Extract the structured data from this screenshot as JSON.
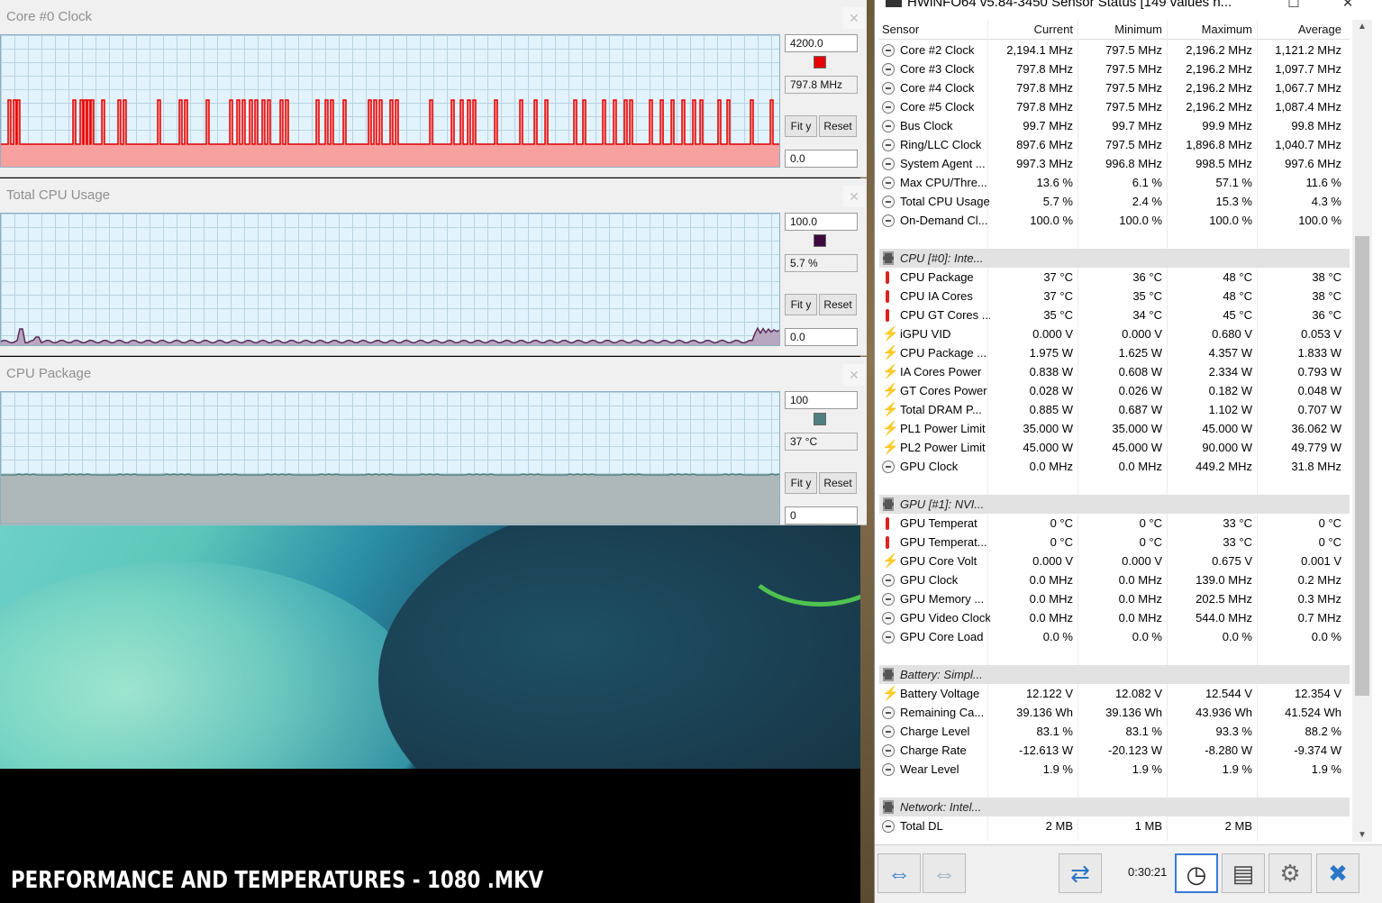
{
  "graphs": [
    {
      "title": "Core #0 Clock",
      "max": "4200.0",
      "current": "797.8 MHz",
      "min": "0.0",
      "color": "#e60000",
      "fit_label": "Fit y",
      "reset_label": "Reset"
    },
    {
      "title": "Total CPU Usage",
      "max": "100.0",
      "current": "5.7 %",
      "min": "0.0",
      "color": "#3c0a3c",
      "fit_label": "Fit y",
      "reset_label": "Reset"
    },
    {
      "title": "CPU Package",
      "max": "100",
      "current": "37 °C",
      "min": "0",
      "color": "#4f7f7f",
      "fit_label": "Fit y",
      "reset_label": "Reset"
    }
  ],
  "video_caption": "PERFORMANCE AND TEMPERATURES - 1080 .MKV",
  "hwinfo": {
    "title": "HWiNFO64 v5.84-3450 Sensor Status [149 values h...",
    "columns": {
      "sensor": "Sensor",
      "current": "Current",
      "minimum": "Minimum",
      "maximum": "Maximum",
      "average": "Average"
    },
    "timer": "0:30:21",
    "rows": [
      {
        "type": "clock",
        "name": "Core #2 Clock",
        "cur": "2,194.1 MHz",
        "min": "797.5 MHz",
        "max": "2,196.2 MHz",
        "avg": "1,121.2 MHz"
      },
      {
        "type": "clock",
        "name": "Core #3 Clock",
        "cur": "797.8 MHz",
        "min": "797.5 MHz",
        "max": "2,196.2 MHz",
        "avg": "1,097.7 MHz"
      },
      {
        "type": "clock",
        "name": "Core #4 Clock",
        "cur": "797.8 MHz",
        "min": "797.5 MHz",
        "max": "2,196.2 MHz",
        "avg": "1,067.7 MHz"
      },
      {
        "type": "clock",
        "name": "Core #5 Clock",
        "cur": "797.8 MHz",
        "min": "797.5 MHz",
        "max": "2,196.2 MHz",
        "avg": "1,087.4 MHz"
      },
      {
        "type": "clock",
        "name": "Bus Clock",
        "cur": "99.7 MHz",
        "min": "99.7 MHz",
        "max": "99.9 MHz",
        "avg": "99.8 MHz"
      },
      {
        "type": "clock",
        "name": "Ring/LLC Clock",
        "cur": "897.6 MHz",
        "min": "797.5 MHz",
        "max": "1,896.8 MHz",
        "avg": "1,040.7 MHz"
      },
      {
        "type": "clock",
        "name": "System Agent ...",
        "cur": "997.3 MHz",
        "min": "996.8 MHz",
        "max": "998.5 MHz",
        "avg": "997.6 MHz"
      },
      {
        "type": "clock",
        "name": "Max CPU/Thre...",
        "cur": "13.6 %",
        "min": "6.1 %",
        "max": "57.1 %",
        "avg": "11.6 %"
      },
      {
        "type": "clock",
        "name": "Total CPU Usage",
        "cur": "5.7 %",
        "min": "2.4 %",
        "max": "15.3 %",
        "avg": "4.3 %"
      },
      {
        "type": "clock",
        "name": "On-Demand Cl...",
        "cur": "100.0 %",
        "min": "100.0 %",
        "max": "100.0 %",
        "avg": "100.0 %"
      },
      {
        "type": "blank",
        "name": "",
        "cur": "",
        "min": "",
        "max": "",
        "avg": ""
      },
      {
        "type": "group",
        "name": "CPU [#0]: Inte...",
        "cur": "",
        "min": "",
        "max": "",
        "avg": ""
      },
      {
        "type": "temp",
        "name": "CPU Package",
        "cur": "37 °C",
        "min": "36 °C",
        "max": "48 °C",
        "avg": "38 °C"
      },
      {
        "type": "temp",
        "name": "CPU IA Cores",
        "cur": "37 °C",
        "min": "35 °C",
        "max": "48 °C",
        "avg": "38 °C"
      },
      {
        "type": "temp",
        "name": "CPU GT Cores ...",
        "cur": "35 °C",
        "min": "34 °C",
        "max": "45 °C",
        "avg": "36 °C"
      },
      {
        "type": "volt",
        "name": "iGPU VID",
        "cur": "0.000 V",
        "min": "0.000 V",
        "max": "0.680 V",
        "avg": "0.053 V"
      },
      {
        "type": "volt",
        "name": "CPU Package ...",
        "cur": "1.975 W",
        "min": "1.625 W",
        "max": "4.357 W",
        "avg": "1.833 W"
      },
      {
        "type": "volt",
        "name": "IA Cores Power",
        "cur": "0.838 W",
        "min": "0.608 W",
        "max": "2.334 W",
        "avg": "0.793 W"
      },
      {
        "type": "volt",
        "name": "GT Cores Power",
        "cur": "0.028 W",
        "min": "0.026 W",
        "max": "0.182 W",
        "avg": "0.048 W"
      },
      {
        "type": "volt",
        "name": "Total DRAM P...",
        "cur": "0.885 W",
        "min": "0.687 W",
        "max": "1.102 W",
        "avg": "0.707 W"
      },
      {
        "type": "volt",
        "name": "PL1 Power Limit",
        "cur": "35.000 W",
        "min": "35.000 W",
        "max": "45.000 W",
        "avg": "36.062 W"
      },
      {
        "type": "volt",
        "name": "PL2 Power Limit",
        "cur": "45.000 W",
        "min": "45.000 W",
        "max": "90.000 W",
        "avg": "49.779 W"
      },
      {
        "type": "clock",
        "name": "GPU Clock",
        "cur": "0.0 MHz",
        "min": "0.0 MHz",
        "max": "449.2 MHz",
        "avg": "31.8 MHz"
      },
      {
        "type": "blank",
        "name": "",
        "cur": "",
        "min": "",
        "max": "",
        "avg": ""
      },
      {
        "type": "group",
        "name": "GPU [#1]: NVI...",
        "cur": "",
        "min": "",
        "max": "",
        "avg": ""
      },
      {
        "type": "temp",
        "name": "GPU Temperat",
        "cur": "0 °C",
        "min": "0 °C",
        "max": "33 °C",
        "avg": "0 °C"
      },
      {
        "type": "temp",
        "name": "GPU Temperat...",
        "cur": "0 °C",
        "min": "0 °C",
        "max": "33 °C",
        "avg": "0 °C"
      },
      {
        "type": "volt",
        "name": "GPU Core Volt",
        "cur": "0.000 V",
        "min": "0.000 V",
        "max": "0.675 V",
        "avg": "0.001 V"
      },
      {
        "type": "clock",
        "name": "GPU Clock",
        "cur": "0.0 MHz",
        "min": "0.0 MHz",
        "max": "139.0 MHz",
        "avg": "0.2 MHz"
      },
      {
        "type": "clock",
        "name": "GPU Memory ...",
        "cur": "0.0 MHz",
        "min": "0.0 MHz",
        "max": "202.5 MHz",
        "avg": "0.3 MHz"
      },
      {
        "type": "clock",
        "name": "GPU Video Clock",
        "cur": "0.0 MHz",
        "min": "0.0 MHz",
        "max": "544.0 MHz",
        "avg": "0.7 MHz"
      },
      {
        "type": "clock",
        "name": "GPU Core Load",
        "cur": "0.0 %",
        "min": "0.0 %",
        "max": "0.0 %",
        "avg": "0.0 %"
      },
      {
        "type": "blank",
        "name": "",
        "cur": "",
        "min": "",
        "max": "",
        "avg": ""
      },
      {
        "type": "group",
        "name": "Battery: Simpl...",
        "cur": "",
        "min": "",
        "max": "",
        "avg": ""
      },
      {
        "type": "volt",
        "name": "Battery Voltage",
        "cur": "12.122 V",
        "min": "12.082 V",
        "max": "12.544 V",
        "avg": "12.354 V"
      },
      {
        "type": "clock",
        "name": "Remaining Ca...",
        "cur": "39.136 Wh",
        "min": "39.136 Wh",
        "max": "43.936 Wh",
        "avg": "41.524 Wh"
      },
      {
        "type": "clock",
        "name": "Charge Level",
        "cur": "83.1 %",
        "min": "83.1 %",
        "max": "93.3 %",
        "avg": "88.2 %"
      },
      {
        "type": "clock",
        "name": "Charge Rate",
        "cur": "-12.613 W",
        "min": "-20.123 W",
        "max": "-8.280 W",
        "avg": "-9.374 W"
      },
      {
        "type": "clock",
        "name": "Wear Level",
        "cur": "1.9 %",
        "min": "1.9 %",
        "max": "1.9 %",
        "avg": "1.9 %"
      },
      {
        "type": "blank",
        "name": "",
        "cur": "",
        "min": "",
        "max": "",
        "avg": ""
      },
      {
        "type": "group",
        "name": "Network: Intel...",
        "cur": "",
        "min": "",
        "max": "",
        "avg": ""
      },
      {
        "type": "clock",
        "name": "Total DL",
        "cur": "2 MB",
        "min": "1 MB",
        "max": "2 MB",
        "avg": ""
      }
    ]
  }
}
